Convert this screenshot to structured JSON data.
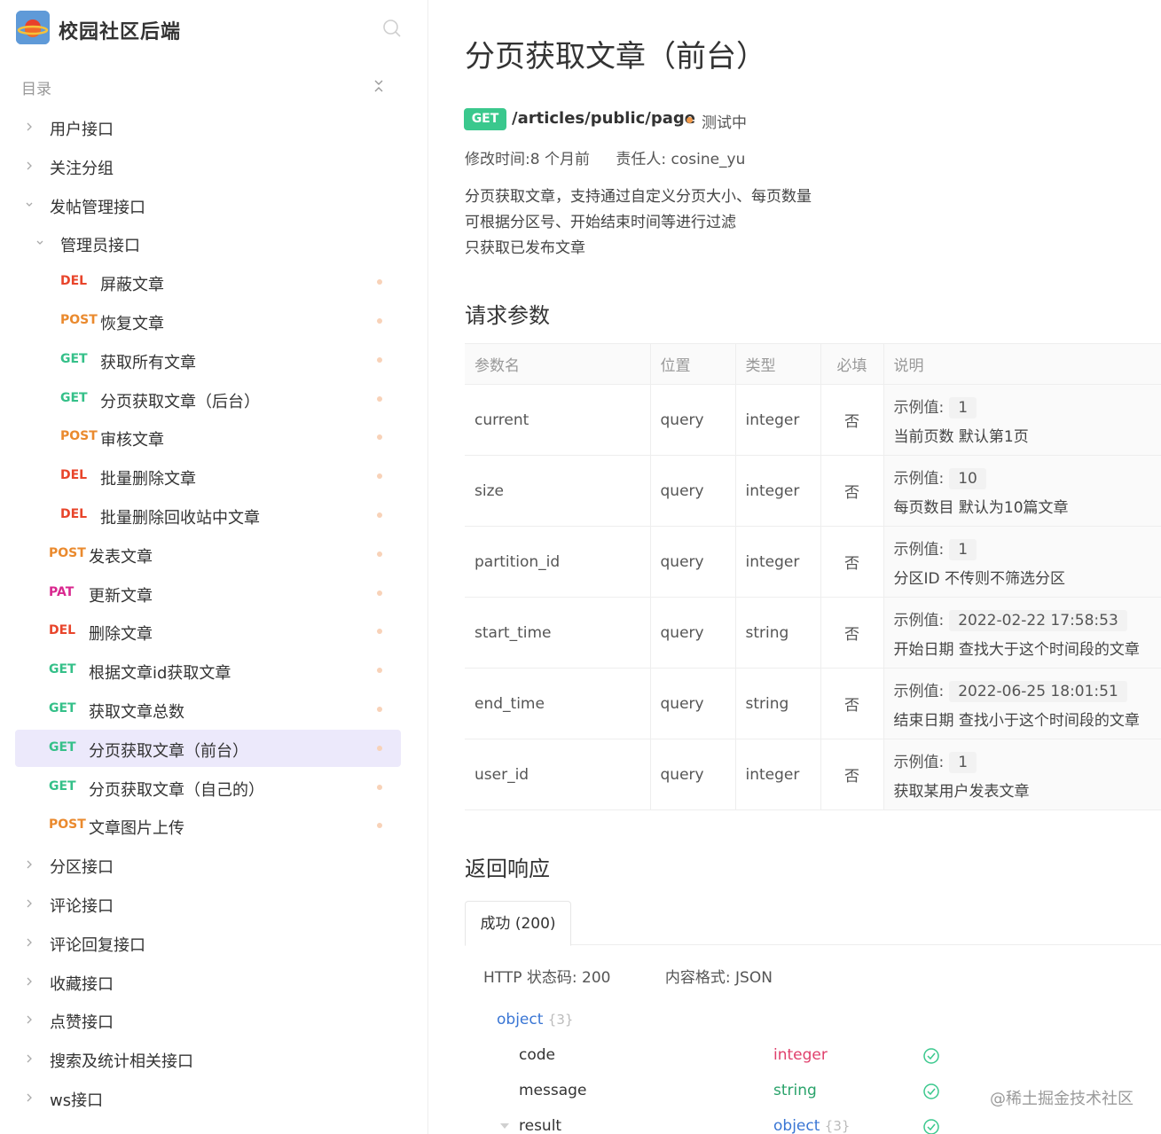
{
  "sidebar": {
    "app_title": "校园社区后端",
    "toc_label": "目录",
    "items": [
      {
        "label": "用户接口",
        "level": 0,
        "expanded": false
      },
      {
        "label": "关注分组",
        "level": 0,
        "expanded": false
      },
      {
        "label": "发帖管理接口",
        "level": 0,
        "expanded": true
      },
      {
        "label": "管理员接口",
        "level": 1,
        "expanded": true
      },
      {
        "method": "DEL",
        "label": "屏蔽文章",
        "level": 2
      },
      {
        "method": "POST",
        "label": "恢复文章",
        "level": 2
      },
      {
        "method": "GET",
        "label": "获取所有文章",
        "level": 2
      },
      {
        "method": "GET",
        "label": "分页获取文章（后台）",
        "level": 2
      },
      {
        "method": "POST",
        "label": "审核文章",
        "level": 2
      },
      {
        "method": "DEL",
        "label": "批量删除文章",
        "level": 2
      },
      {
        "method": "DEL",
        "label": "批量删除回收站中文章",
        "level": 2
      },
      {
        "method": "POST",
        "label": "发表文章",
        "level": 1
      },
      {
        "method": "PAT",
        "label": "更新文章",
        "level": 1
      },
      {
        "method": "DEL",
        "label": "删除文章",
        "level": 1
      },
      {
        "method": "GET",
        "label": "根据文章id获取文章",
        "level": 1
      },
      {
        "method": "GET",
        "label": "获取文章总数",
        "level": 1
      },
      {
        "method": "GET",
        "label": "分页获取文章（前台）",
        "level": 1,
        "active": true
      },
      {
        "method": "GET",
        "label": "分页获取文章（自己的）",
        "level": 1
      },
      {
        "method": "POST",
        "label": "文章图片上传",
        "level": 1
      },
      {
        "label": "分区接口",
        "level": 0,
        "expanded": false
      },
      {
        "label": "评论接口",
        "level": 0,
        "expanded": false
      },
      {
        "label": "评论回复接口",
        "level": 0,
        "expanded": false
      },
      {
        "label": "收藏接口",
        "level": 0,
        "expanded": false
      },
      {
        "label": "点赞接口",
        "level": 0,
        "expanded": false
      },
      {
        "label": "搜索及统计相关接口",
        "level": 0,
        "expanded": false
      },
      {
        "label": "ws接口",
        "level": 0,
        "expanded": false
      }
    ]
  },
  "main": {
    "title": "分页获取文章（前台）",
    "method": "GET",
    "path": "/articles/public/page",
    "status": "测试中",
    "modified": "修改时间:8 个月前",
    "owner": "责任人: cosine_yu",
    "description": [
      "分页获取文章，支持通过自定义分页大小、每页数量",
      "可根据分区号、开始结束时间等进行过滤",
      "只获取已发布文章"
    ],
    "params_title": "请求参数",
    "params_headers": [
      "参数名",
      "位置",
      "类型",
      "必填",
      "说明"
    ],
    "example_label": "示例值:",
    "params": [
      {
        "name": "current",
        "in": "query",
        "type": "integer",
        "required": "否",
        "example": "1",
        "note": "当前页数 默认第1页"
      },
      {
        "name": "size",
        "in": "query",
        "type": "integer",
        "required": "否",
        "example": "10",
        "note": "每页数目 默认为10篇文章"
      },
      {
        "name": "partition_id",
        "in": "query",
        "type": "integer",
        "required": "否",
        "example": "1",
        "note": "分区ID 不传则不筛选分区"
      },
      {
        "name": "start_time",
        "in": "query",
        "type": "string",
        "required": "否",
        "example": "2022-02-22 17:58:53",
        "note": "开始日期 查找大于这个时间段的文章"
      },
      {
        "name": "end_time",
        "in": "query",
        "type": "string",
        "required": "否",
        "example": "2022-06-25 18:01:51",
        "note": "结束日期 查找小于这个时间段的文章"
      },
      {
        "name": "user_id",
        "in": "query",
        "type": "integer",
        "required": "否",
        "example": "1",
        "note": "获取某用户发表文章"
      }
    ],
    "response_title": "返回响应",
    "response_tab": "成功 (200)",
    "http_status": "HTTP 状态码: 200",
    "content_type": "内容格式: JSON",
    "schema": {
      "root_type": "object",
      "root_count": "{3}",
      "fields": [
        {
          "name": "code",
          "type": "integer"
        },
        {
          "name": "message",
          "type": "string"
        },
        {
          "name": "result",
          "type": "object",
          "count": "{3}"
        }
      ]
    }
  },
  "watermark": "@稀土掘金技术社区",
  "colors": {
    "get": "#35c089",
    "post": "#ea8a2e",
    "del": "#e8452b",
    "pat": "#d9288f",
    "active_bg": "#ece9fb",
    "accent": "#3a76d4"
  }
}
